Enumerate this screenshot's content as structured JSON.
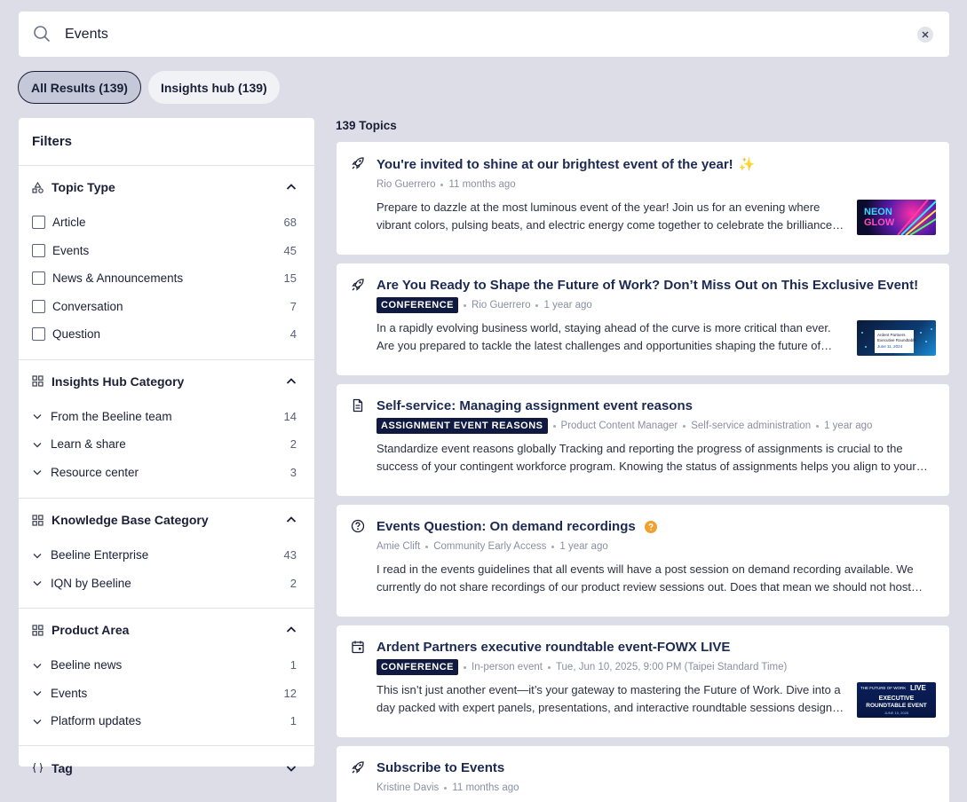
{
  "search": {
    "value": "Events"
  },
  "scope_tabs": [
    {
      "label": "All Results (139)",
      "active": true
    },
    {
      "label": "Insights hub (139)",
      "active": false
    }
  ],
  "filters": {
    "title": "Filters",
    "topic_type": {
      "title": "Topic Type",
      "items": [
        {
          "label": "Article",
          "count": "68"
        },
        {
          "label": "Events",
          "count": "45"
        },
        {
          "label": "News & Announcements",
          "count": "15"
        },
        {
          "label": "Conversation",
          "count": "7"
        },
        {
          "label": "Question",
          "count": "4"
        }
      ]
    },
    "insights_hub_category": {
      "title": "Insights Hub Category",
      "items": [
        {
          "label": "From the Beeline team",
          "count": "14"
        },
        {
          "label": "Learn & share",
          "count": "2"
        },
        {
          "label": "Resource center",
          "count": "3"
        }
      ]
    },
    "knowledge_base_category": {
      "title": "Knowledge Base Category",
      "items": [
        {
          "label": "Beeline Enterprise",
          "count": "43"
        },
        {
          "label": "IQN by Beeline",
          "count": "2"
        }
      ]
    },
    "product_area": {
      "title": "Product Area",
      "items": [
        {
          "label": "Beeline news",
          "count": "1"
        },
        {
          "label": "Events",
          "count": "12"
        },
        {
          "label": "Platform updates",
          "count": "1"
        }
      ]
    },
    "tag": {
      "title": "Tag"
    }
  },
  "results": {
    "count_label": "139 Topics",
    "items": [
      {
        "title": "You're invited to shine at our brightest event of the year!",
        "emoji": "✨",
        "author": "Rio Guerrero",
        "time": "11 months ago",
        "excerpt": "Prepare to dazzle at the most luminous event of the year! Join us for an evening where vibrant colors, pulsing beats, and electric energy come together to celebrate the brilliance of our community."
      },
      {
        "title": "Are You Ready to Shape the Future of Work? Don’t Miss Out on This Exclusive Event!",
        "badge": "CONFERENCE",
        "author": "Rio Guerrero",
        "time": "1 year ago",
        "excerpt": "In a rapidly evolving business world, staying ahead of the curve is more critical than ever. Are you prepared to tackle the latest challenges and opportunities shaping the future of work?"
      },
      {
        "title": "Self-service: Managing assignment event reasons",
        "badge": "ASSIGNMENT EVENT REASONS",
        "author": "Product Content Manager",
        "category": "Self-service administration",
        "time": "1 year ago",
        "excerpt": "Standardize event reasons globally Tracking and reporting the progress of assignments is crucial to the success of your contingent workforce program. Knowing the status of assignments helps you align to your goals."
      },
      {
        "title": "Events Question: On demand recordings",
        "author": "Amie Clift",
        "category": "Community Early Access",
        "time": "1 year ago",
        "excerpt": "I read in the events guidelines that all events will have a post session on demand recording available. We currently do not share recordings of our product review sessions out. Does that mean we should not host them?"
      },
      {
        "title": "Ardent Partners executive roundtable event-FOWX LIVE",
        "badge": "CONFERENCE",
        "location": "In-person event",
        "time": "Tue, Jun 10, 2025, 9:00 PM (Taipei Standard Time)",
        "excerpt": "This isn’t just another event—it’s your gateway to mastering the Future of Work. Dive into a day packed with expert panels, presentations, and interactive roundtable sessions designed for leaders."
      },
      {
        "title": "Subscribe to Events",
        "author": "Kristine Davis",
        "time": "11 months ago"
      }
    ]
  },
  "thumbs": {
    "neon": {
      "line1": "NEON",
      "line2": "GLOW"
    },
    "fow": {
      "line1": "Ardent Partners",
      "line2": "Executive Roundtable",
      "line3": "June 11, 2024"
    },
    "fowx": {
      "line1": "THE FUTURE OF WORK",
      "line2": "LIVE",
      "line3": "EXECUTIVE",
      "line4": "ROUNDTABLE EVENT",
      "line5": "JUNE 10, 2025"
    }
  }
}
